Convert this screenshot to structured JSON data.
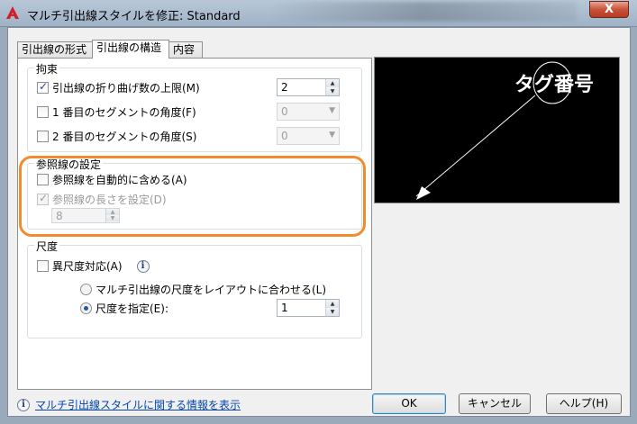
{
  "window": {
    "title": "マルチ引出線スタイルを修正: Standard",
    "close_label": "X"
  },
  "tabs": [
    {
      "label": "引出線の形式"
    },
    {
      "label": "引出線の構造"
    },
    {
      "label": "内容"
    }
  ],
  "constraints": {
    "title": "拘束",
    "max_bend_points": {
      "label": "引出線の折り曲げ数の上限(M)",
      "checked": true,
      "value": "2"
    },
    "first_segment_angle": {
      "label": "1 番目のセグメントの角度(F)",
      "checked": false,
      "value": "0"
    },
    "second_segment_angle": {
      "label": "2 番目のセグメントの角度(S)",
      "checked": false,
      "value": "0"
    }
  },
  "landing": {
    "title": "参照線の設定",
    "auto_include": {
      "label": "参照線を自動的に含める(A)",
      "checked": false
    },
    "set_distance": {
      "label": "参照線の長さを設定(D)",
      "checked": true,
      "disabled": true
    },
    "distance_value": "8"
  },
  "scale": {
    "title": "尺度",
    "annotative": {
      "label": "異尺度対応(A)",
      "checked": false
    },
    "info_icon_glyph": "i",
    "scale_to_layout": {
      "label": "マルチ引出線の尺度をレイアウトに合わせる(L)",
      "selected": false
    },
    "specify_scale": {
      "label": "尺度を指定(E):",
      "selected": true,
      "value": "1"
    }
  },
  "preview": {
    "tag_text": "タグ番号"
  },
  "footer": {
    "help_link": "マルチ引出線スタイルに関する情報を表示",
    "ok": "OK",
    "cancel": "キャンセル",
    "help": "ヘルプ(H)"
  },
  "colors": {
    "highlight": "#f28a2e",
    "preview_bg": "#000000",
    "link": "#0645ad"
  },
  "icons": {
    "app": "autocad-a-icon",
    "info": "info-icon",
    "close": "close-icon"
  }
}
